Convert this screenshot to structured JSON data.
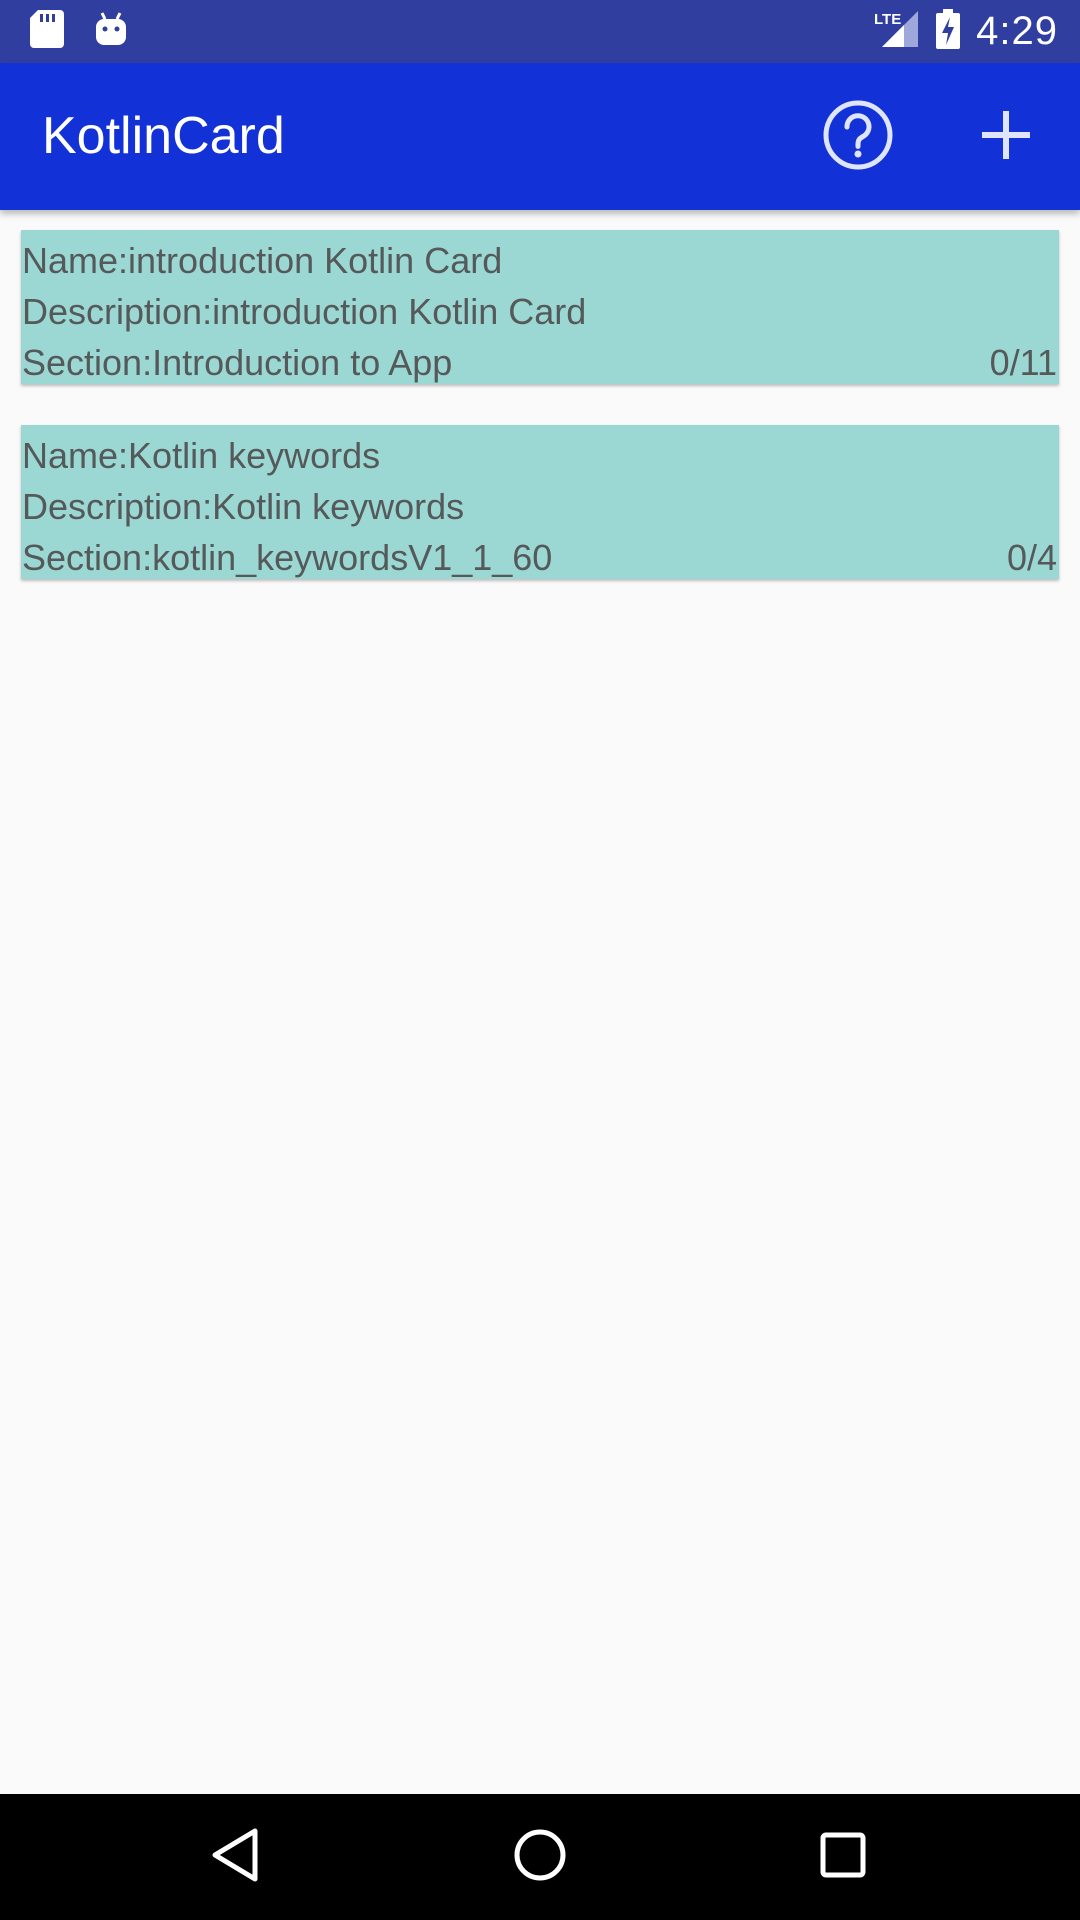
{
  "status_bar": {
    "time": "4:29",
    "network": "LTE",
    "left_icons": [
      "sd-card-icon",
      "android-debug-icon"
    ],
    "right_icons": [
      "signal-icon",
      "battery-charging-icon"
    ]
  },
  "app_bar": {
    "title": "KotlinCard",
    "actions": [
      "help-icon",
      "add-icon"
    ],
    "color": "#1231d6"
  },
  "cards": [
    {
      "name": "Name:introduction Kotlin Card",
      "description": "Description:introduction Kotlin Card",
      "section": "Section:Introduction to App",
      "progress": "0/11"
    },
    {
      "name": "Name:Kotlin keywords",
      "description": "Description:Kotlin keywords",
      "section": "Section:kotlin_keywordsV1_1_60",
      "progress": "0/4"
    }
  ],
  "card_color": "#9bd8d4",
  "nav_bar": {
    "buttons": [
      "back-icon",
      "home-icon",
      "recents-icon"
    ]
  }
}
